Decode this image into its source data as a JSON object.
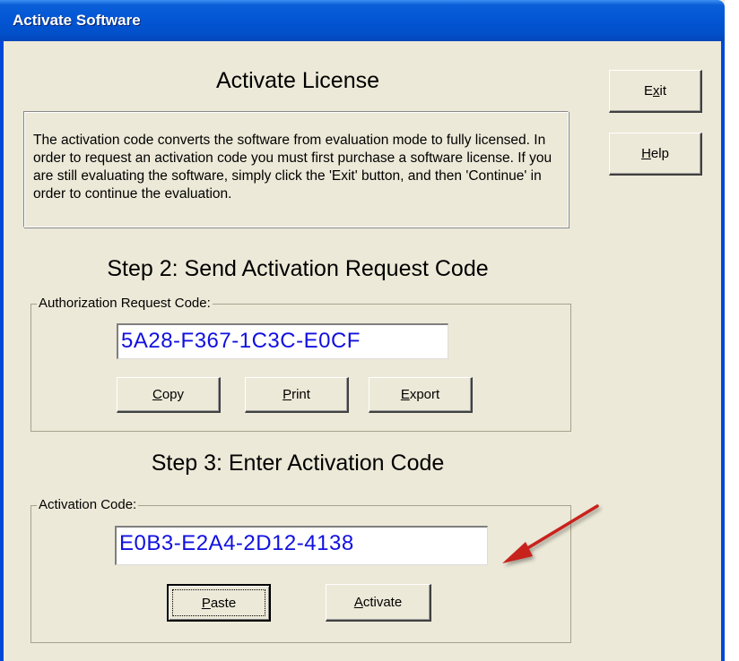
{
  "window": {
    "title": "Activate Software"
  },
  "header": {
    "title": "Activate License",
    "description": "The activation code converts the software from evaluation mode to fully licensed.  In order to request an activation code you must first purchase a software license.  If you are still evaluating the software, simply click the 'Exit' button, and then 'Continue' in order to continue the evaluation."
  },
  "side_buttons": {
    "exit": {
      "pre": "E",
      "key": "x",
      "post": "it"
    },
    "help": {
      "pre": "",
      "key": "H",
      "post": "elp"
    }
  },
  "step2": {
    "title": "Step 2: Send Activation Request Code",
    "group_label": "Authorization Request Code:",
    "code": "5A28-F367-1C3C-E0CF",
    "buttons": {
      "copy": {
        "pre": "",
        "key": "C",
        "post": "opy"
      },
      "print": {
        "pre": "",
        "key": "P",
        "post": "rint"
      },
      "export": {
        "pre": "",
        "key": "E",
        "post": "xport"
      }
    }
  },
  "step3": {
    "title": "Step 3: Enter Activation Code",
    "group_label": "Activation Code:",
    "code": "E0B3-E2A4-2D12-4138",
    "buttons": {
      "paste": {
        "pre": "",
        "key": "P",
        "post": "aste"
      },
      "activate": {
        "pre": "",
        "key": "A",
        "post": "ctivate"
      }
    }
  },
  "colors": {
    "titlebar": "#0355d4",
    "dialog_bg": "#ece9d8",
    "code_text": "#1010e0",
    "annotation_arrow": "#c8201e"
  },
  "annotation": {
    "icon": "red-arrow-icon"
  }
}
